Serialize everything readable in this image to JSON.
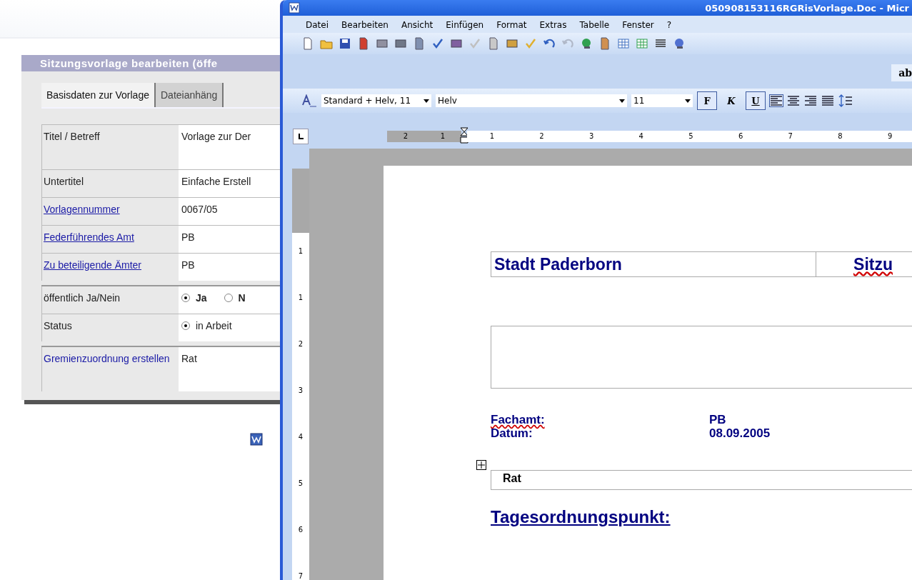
{
  "web_page": {
    "panel_title": "Sitzungsvorlage bearbeiten (öffe",
    "tabs": [
      {
        "label": "Basisdaten zur Vorlage",
        "selected": true
      },
      {
        "label": "Dateianhäng",
        "selected": false
      }
    ],
    "form_rows": [
      {
        "label": "Titel / Betreff",
        "kind": "text",
        "link": false,
        "underlined": false,
        "value": "Vorlage zur Der",
        "group_start": false,
        "tall": true
      },
      {
        "label": "Untertitel",
        "kind": "text",
        "link": false,
        "underlined": false,
        "value": "Einfache Erstell",
        "group_start": false,
        "tall": false
      },
      {
        "label": "Vorlagennummer",
        "kind": "text",
        "link": true,
        "underlined": true,
        "value": "0067/05",
        "group_start": false,
        "tall": false
      },
      {
        "label": "Federführendes Amt",
        "kind": "text",
        "link": true,
        "underlined": true,
        "value": "PB",
        "group_start": false,
        "tall": false
      },
      {
        "label": "Zu beteiligende Ämter",
        "kind": "text",
        "link": true,
        "underlined": true,
        "value": "PB",
        "group_start": false,
        "tall": false
      },
      {
        "label": "öffentlich Ja/Nein",
        "kind": "radio",
        "link": false,
        "underlined": false,
        "bold": true,
        "options": [
          {
            "label": "Ja",
            "selected": true
          },
          {
            "label": "N",
            "selected": false
          }
        ],
        "group_start": true,
        "tall": false
      },
      {
        "label": "Status",
        "kind": "radio",
        "link": false,
        "underlined": false,
        "bold": false,
        "options": [
          {
            "label": "in Arbeit",
            "selected": true
          }
        ],
        "group_start": false,
        "tall": false
      },
      {
        "label": "Gremienzuordnung erstellen",
        "kind": "text",
        "link": true,
        "underlined": false,
        "value": "Rat",
        "group_start": true,
        "tall": true
      }
    ]
  },
  "word": {
    "title": "050908153116RGRisVorlage.Doc - Micr",
    "menu": [
      "Datei",
      "Bearbeiten",
      "Ansicht",
      "Einfügen",
      "Format",
      "Extras",
      "Tabelle",
      "Fenster",
      "?"
    ],
    "extra_toolbar_text": "ab",
    "style_box": "Standard + Helv, 11",
    "font_box": "Helv",
    "size_box": "11",
    "format_buttons": [
      {
        "label": "F",
        "kind": "bold",
        "selected": true
      },
      {
        "label": "K",
        "kind": "italic",
        "selected": false
      },
      {
        "label": "U",
        "kind": "underline",
        "selected": true
      }
    ],
    "ruler": {
      "left_labels": [
        "2",
        "1"
      ],
      "right_labels": [
        "1",
        "2",
        "3",
        "4",
        "5",
        "6",
        "7",
        "8",
        "9"
      ]
    },
    "vertical_ruler": [
      "1",
      "1",
      "2",
      "3",
      "4",
      "5",
      "6",
      "7"
    ],
    "document": {
      "header_cells": [
        {
          "text": "Stadt Paderborn",
          "spell_error": false
        },
        {
          "text": "Sitzu",
          "spell_error": true
        }
      ],
      "fields": [
        {
          "label": "Fachamt:",
          "label_spell_error": true,
          "value": "PB"
        },
        {
          "label": "Datum:",
          "label_spell_error": false,
          "value": "08.09.2005"
        }
      ],
      "table_cell": "Rat",
      "heading": "Tagesordnungspunkt:"
    }
  }
}
